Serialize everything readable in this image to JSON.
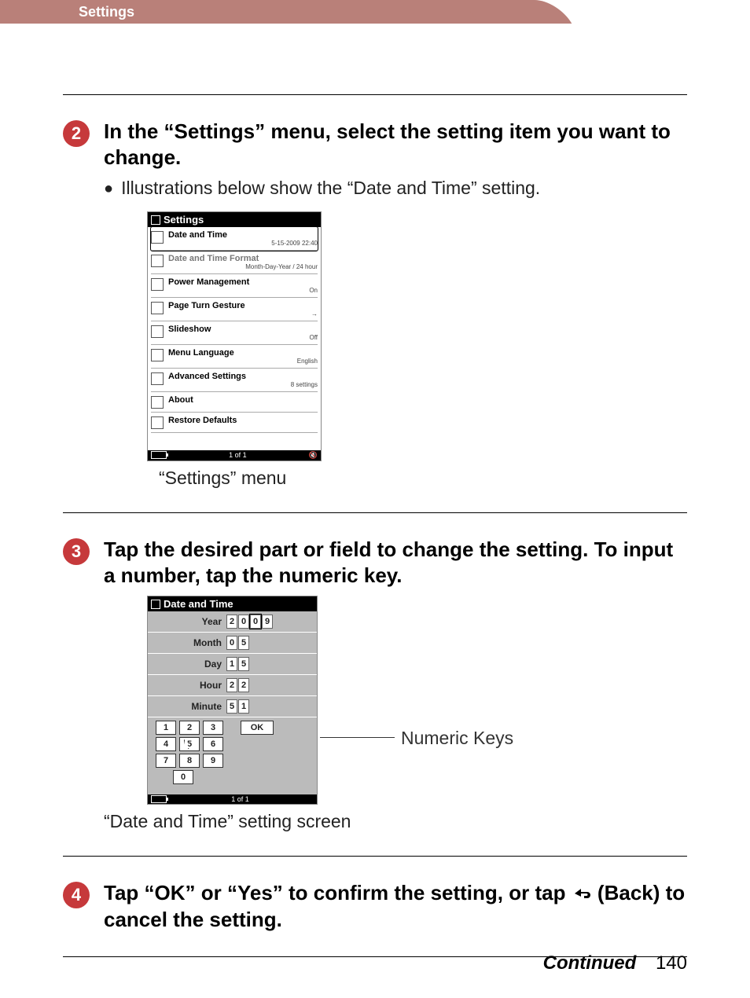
{
  "header": {
    "tab": "Settings"
  },
  "steps": {
    "s2": {
      "num": "2",
      "title": "In the “Settings” menu, select the setting item you want to change.",
      "bullet": "Illustrations below show the “Date and Time” setting.",
      "caption": "“Settings” menu"
    },
    "s3": {
      "num": "3",
      "title": "Tap the desired part or field to change the setting. To input a number, tap the numeric key.",
      "leader_label": "Numeric Keys",
      "caption": "“Date and Time” setting screen"
    },
    "s4": {
      "num": "4",
      "title_a": "Tap “OK” or “Yes” to confirm the setting, or tap ",
      "title_b": " (Back) to cancel the setting."
    }
  },
  "settings_list": {
    "title": "Settings",
    "pager": "1 of 1",
    "rows": [
      {
        "name": "Date and Time",
        "value": "5-15-2009 22:40",
        "selected": true
      },
      {
        "name": "Date and Time Format",
        "value": "Month-Day-Year / 24 hour",
        "dim": true
      },
      {
        "name": "Power Management",
        "value": "On"
      },
      {
        "name": "Page Turn Gesture",
        "value": "→"
      },
      {
        "name": "Slideshow",
        "value": "Off"
      },
      {
        "name": "Menu Language",
        "value": "English"
      },
      {
        "name": "Advanced Settings",
        "value": "8 settings"
      },
      {
        "name": "About",
        "value": ""
      },
      {
        "name": "Restore Defaults",
        "value": ""
      }
    ]
  },
  "datetime_screen": {
    "title": "Date and Time",
    "pager": "1 of 1",
    "fields": {
      "year": {
        "label": "Year",
        "digits": [
          "2",
          "0",
          "0",
          "9"
        ],
        "highlight_index": 2
      },
      "month": {
        "label": "Month",
        "digits": [
          "0",
          "5"
        ]
      },
      "day": {
        "label": "Day",
        "digits": [
          "1",
          "5"
        ]
      },
      "hour": {
        "label": "Hour",
        "digits": [
          "2",
          "2"
        ]
      },
      "minute": {
        "label": "Minute",
        "digits": [
          "5",
          "1"
        ]
      }
    },
    "keypad": {
      "row1": [
        "1",
        "2",
        "3"
      ],
      "ok": "OK",
      "row2": [
        "4",
        "5",
        "6"
      ],
      "row3": [
        "7",
        "8",
        "9"
      ],
      "row4": [
        "0"
      ]
    }
  },
  "footer": {
    "continued": "Continued",
    "page": "140"
  }
}
